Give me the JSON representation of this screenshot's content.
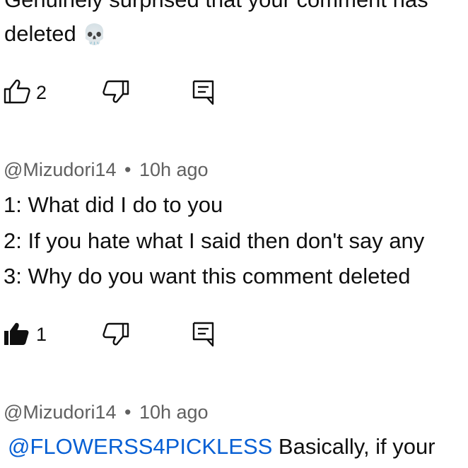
{
  "comments": [
    {
      "text_lines": [
        "Genuinely surprised that your comment has",
        "deleted"
      ],
      "emoji": "💀",
      "likes": "2",
      "liked": false
    },
    {
      "author": "@Mizudori14",
      "separator": "•",
      "time": "10h ago",
      "text_lines": [
        "1: What did I do to you",
        "2: If you hate what I said then don't say any",
        "3: Why do you want this comment deleted"
      ],
      "likes": "1",
      "liked": true
    },
    {
      "author": "@Mizudori14",
      "separator": "•",
      "time": "10h ago",
      "mention": "@FLOWERSS4PICKLESS",
      "text": " Basically, if your"
    }
  ],
  "icons": {
    "like": "thumbs-up-icon",
    "like_filled": "thumbs-up-filled-icon",
    "dislike": "thumbs-down-icon",
    "reply": "reply-comment-icon"
  },
  "colors": {
    "text": "#0f0f0f",
    "meta": "#606060",
    "mention": "#065fd4"
  }
}
